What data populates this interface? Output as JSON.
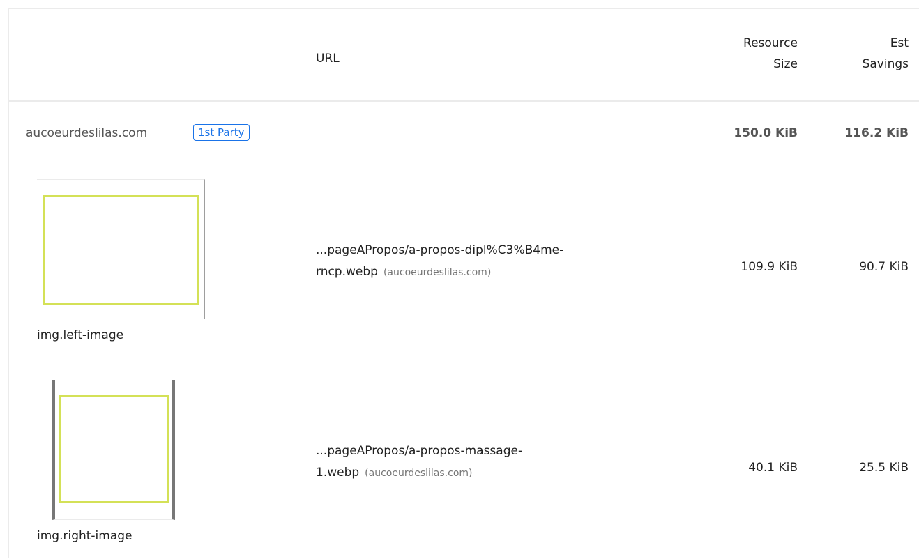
{
  "table": {
    "headers": {
      "url": "URL",
      "resource_size_line1": "Resource",
      "resource_size_line2": "Size",
      "est_savings_line1": "Est",
      "est_savings_line2": "Savings"
    },
    "group": {
      "name": "aucoeurdeslilas.com",
      "badge": "1st Party",
      "resource_size": "150.0 KiB",
      "est_savings": "116.2 KiB"
    },
    "rows": [
      {
        "selector": "img.left-image",
        "url_line1": "...pageAPropos/a-propos-dipl%C3%B4me-",
        "url_line2": "rncp.webp",
        "host": "(aucoeurdeslilas.com)",
        "resource_size": "109.9 KiB",
        "est_savings": "90.7 KiB"
      },
      {
        "selector": "img.right-image",
        "url_line1": "...pageAPropos/a-propos-massage-",
        "url_line2": "1.webp",
        "host": "(aucoeurdeslilas.com)",
        "resource_size": "40.1 KiB",
        "est_savings": "25.5 KiB"
      }
    ]
  },
  "colors": {
    "badge": "#1a73e8",
    "thumbnail_frame": "#d4e157"
  }
}
